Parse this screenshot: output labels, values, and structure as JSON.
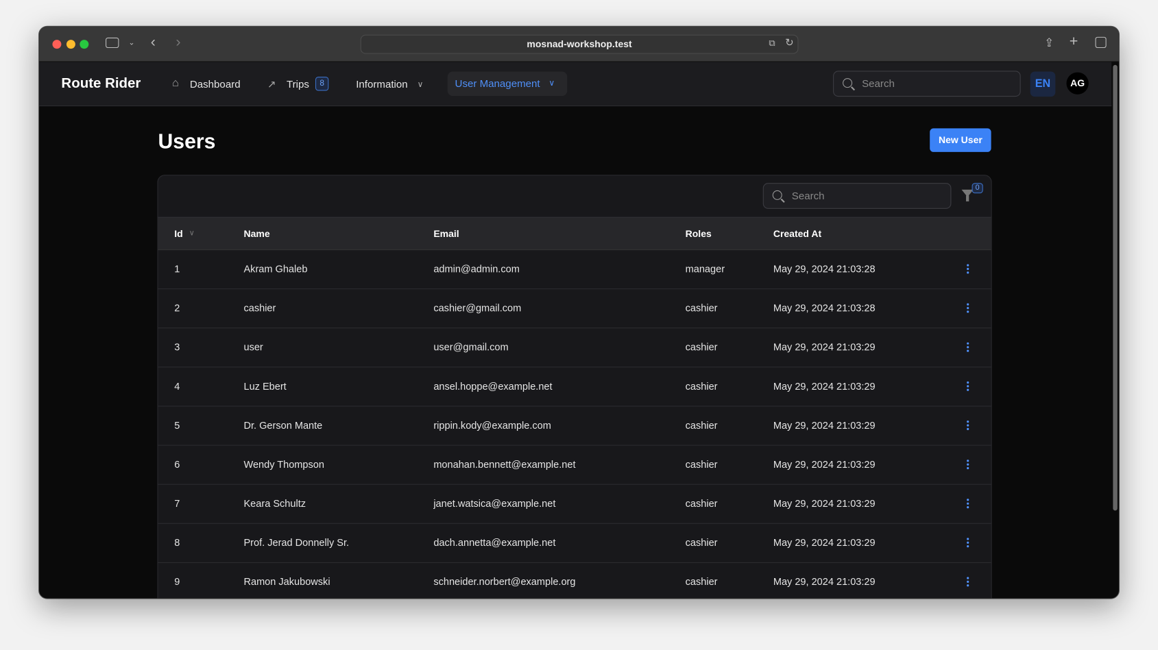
{
  "browser": {
    "url": "mosnad-workshop.test"
  },
  "nav": {
    "brand": "Route Rider",
    "dashboard": "Dashboard",
    "trips": "Trips",
    "trips_badge": "8",
    "information": "Information",
    "user_management": "User Management",
    "search_placeholder": "Search",
    "language": "EN",
    "avatar": "AG",
    "active_color": "#3b82f6"
  },
  "page": {
    "title": "Users",
    "new_user": "New User"
  },
  "table": {
    "search_placeholder": "Search",
    "filter_count": "0",
    "columns": [
      "Id",
      "Name",
      "Email",
      "Roles",
      "Created At"
    ],
    "rows": [
      [
        "1",
        "Akram Ghaleb",
        "admin@admin.com",
        "manager",
        "May 29, 2024 21:03:28"
      ],
      [
        "2",
        "cashier",
        "cashier@gmail.com",
        "cashier",
        "May 29, 2024 21:03:28"
      ],
      [
        "3",
        "user",
        "user@gmail.com",
        "cashier",
        "May 29, 2024 21:03:29"
      ],
      [
        "4",
        "Luz Ebert",
        "ansel.hoppe@example.net",
        "cashier",
        "May 29, 2024 21:03:29"
      ],
      [
        "5",
        "Dr. Gerson Mante",
        "rippin.kody@example.com",
        "cashier",
        "May 29, 2024 21:03:29"
      ],
      [
        "6",
        "Wendy Thompson",
        "monahan.bennett@example.net",
        "cashier",
        "May 29, 2024 21:03:29"
      ],
      [
        "7",
        "Keara Schultz",
        "janet.watsica@example.net",
        "cashier",
        "May 29, 2024 21:03:29"
      ],
      [
        "8",
        "Prof. Jerad Donnelly Sr.",
        "dach.annetta@example.net",
        "cashier",
        "May 29, 2024 21:03:29"
      ],
      [
        "9",
        "Ramon Jakubowski",
        "schneider.norbert@example.org",
        "cashier",
        "May 29, 2024 21:03:29"
      ]
    ]
  }
}
